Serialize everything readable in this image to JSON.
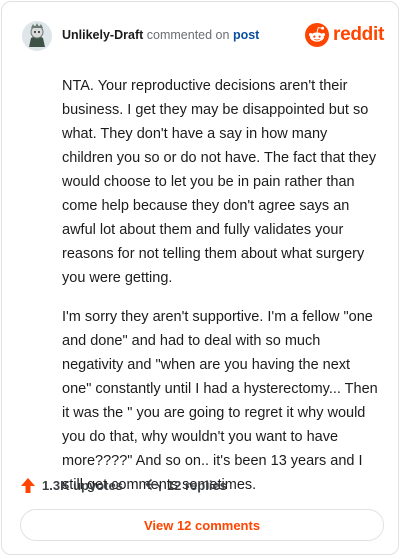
{
  "comment": {
    "username": "Unlikely-Draft",
    "action_text": "commented on",
    "post_link": "post",
    "paragraphs": [
      "NTA. Your reproductive decisions aren't their business. I get they may be disappointed but so what. They don't have a say in how many children you so or do not have. The fact that they would choose to let you be in pain rather than come help because they don't agree says an awful lot about them and fully validates your reasons for not telling them about what surgery you were getting.",
      "I'm sorry they aren't supportive. I'm a fellow \"one and done\" and had to deal with so much negativity and \"when are you having the next one\" constantly until I had a hysterectomy... Then it was the \" you are going to regret it why would you do that, why wouldn't you want to have more????\" And so on.. it's been 13 years and I still get comments sometimes."
    ],
    "upvotes": "1.3K upvotes",
    "replies": "12 replies",
    "view_comments": "View 12 comments"
  },
  "brand": {
    "wordmark": "reddit",
    "color": "#ff4500"
  },
  "icons": {
    "avatar": "snoo-avatar-icon",
    "brand": "reddit-logo-icon",
    "upvote": "upvote-arrow-icon",
    "reply": "reply-arrow-icon"
  }
}
